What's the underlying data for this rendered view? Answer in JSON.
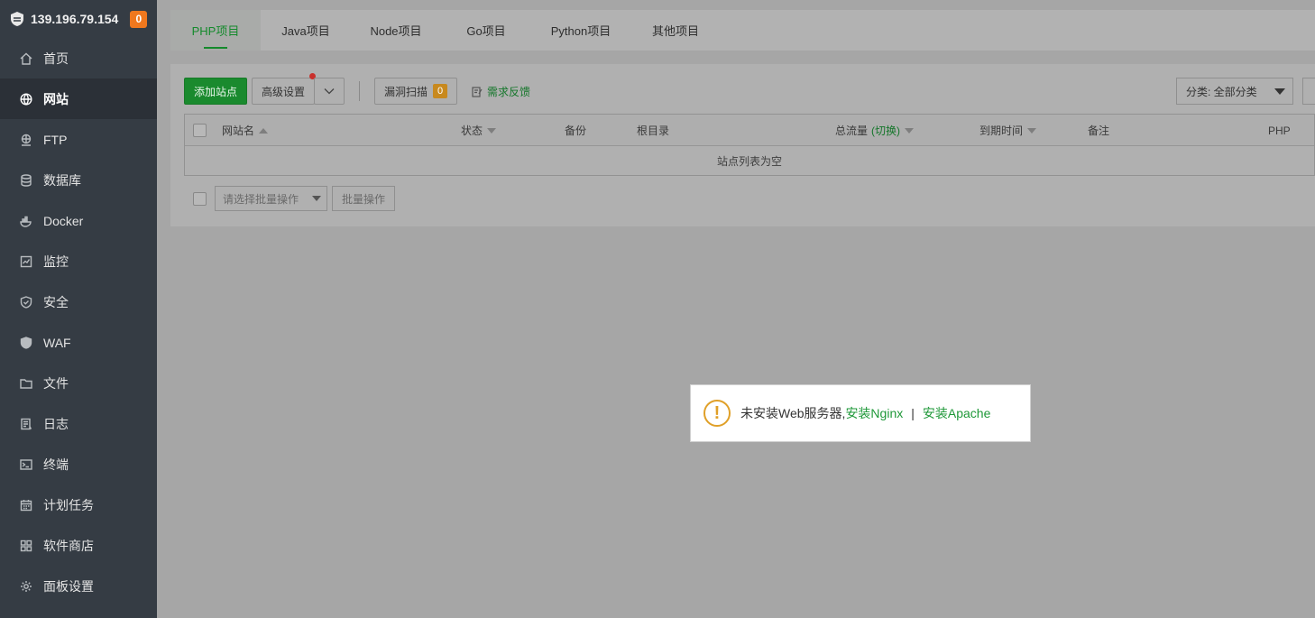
{
  "sidebar": {
    "server_ip": "139.196.79.154",
    "notification_count": "0",
    "items": [
      {
        "label": "首页",
        "icon": "home-icon"
      },
      {
        "label": "网站",
        "icon": "globe-icon",
        "active": true
      },
      {
        "label": "FTP",
        "icon": "ftp-icon"
      },
      {
        "label": "数据库",
        "icon": "database-icon"
      },
      {
        "label": "Docker",
        "icon": "docker-icon"
      },
      {
        "label": "监控",
        "icon": "monitor-icon"
      },
      {
        "label": "安全",
        "icon": "shield-icon"
      },
      {
        "label": "WAF",
        "icon": "waf-icon"
      },
      {
        "label": "文件",
        "icon": "folder-icon"
      },
      {
        "label": "日志",
        "icon": "log-icon"
      },
      {
        "label": "终端",
        "icon": "terminal-icon"
      },
      {
        "label": "计划任务",
        "icon": "calendar-icon"
      },
      {
        "label": "软件商店",
        "icon": "apps-icon"
      },
      {
        "label": "面板设置",
        "icon": "gear-icon"
      }
    ]
  },
  "tabs": [
    {
      "label": "PHP项目",
      "active": true
    },
    {
      "label": "Java项目"
    },
    {
      "label": "Node项目"
    },
    {
      "label": "Go项目"
    },
    {
      "label": "Python项目"
    },
    {
      "label": "其他项目"
    }
  ],
  "toolbar": {
    "add_site": "添加站点",
    "advanced_settings": "高级设置",
    "vuln_scan": "漏洞扫描",
    "vuln_count": "0",
    "feedback": "需求反馈",
    "category_select": "分类: 全部分类"
  },
  "table": {
    "headers": {
      "name": "网站名",
      "status": "状态",
      "backup": "备份",
      "root": "根目录",
      "traffic": "总流量",
      "traffic_toggle": "(切换)",
      "expire": "到期时间",
      "note": "备注",
      "php": "PHP"
    },
    "empty_text": "站点列表为空"
  },
  "batch": {
    "select_placeholder": "请选择批量操作",
    "button": "批量操作"
  },
  "alert": {
    "message": "未安装Web服务器,",
    "install_nginx": "安装Nginx",
    "separator": "|",
    "install_apache": "安装Apache"
  },
  "colors": {
    "sidebar_bg": "#353c44",
    "accent_green": "#1a8a2e",
    "badge_orange": "#f0781e",
    "warning_yellow": "#e0a028"
  }
}
